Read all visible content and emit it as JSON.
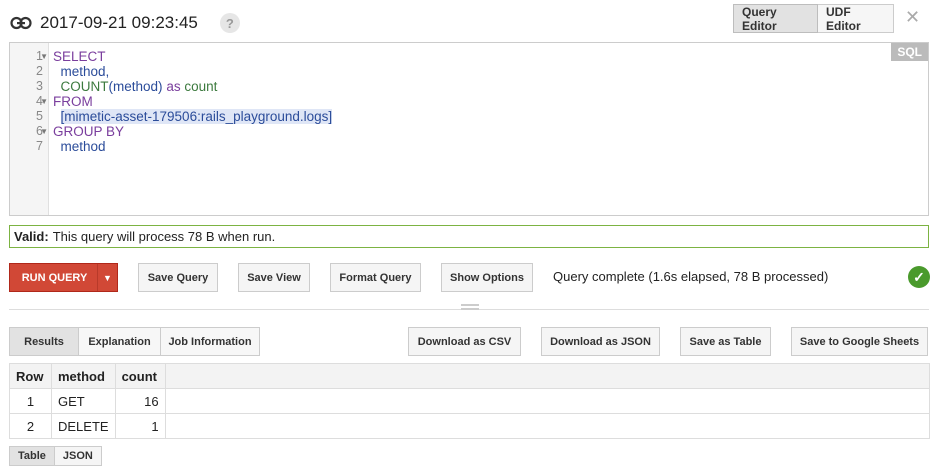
{
  "header": {
    "title": "2017-09-21 09:23:45",
    "help": "?",
    "tabs": [
      {
        "label": "Query Editor",
        "active": true
      },
      {
        "label": "UDF Editor",
        "active": false
      }
    ],
    "close": "✕"
  },
  "editor": {
    "badge": "SQL",
    "line_numbers": [
      "1",
      "2",
      "3",
      "4",
      "5",
      "6",
      "7"
    ],
    "lines": {
      "l1": "SELECT",
      "l2": "method,",
      "l3_fn": "COUNT",
      "l3_paren_open": "(",
      "l3_arg": "method",
      "l3_paren_close": ")",
      "l3_as": "as",
      "l3_alias": "count",
      "l4": "FROM",
      "l5": "[mimetic-asset-179506:rails_playground.logs]",
      "l6": "GROUP BY",
      "l7": "method"
    }
  },
  "validation": {
    "label": "Valid:",
    "message": "This query will process 78 B when run.",
    "color": "#7cb342"
  },
  "toolbar": {
    "run_query": "RUN QUERY",
    "save_query": "Save Query",
    "save_view": "Save View",
    "format_query": "Format Query",
    "show_options": "Show Options",
    "status": "Query complete (1.6s elapsed, 78 B processed)",
    "accent": "#d14836"
  },
  "results": {
    "tabs": [
      {
        "label": "Results",
        "active": true
      },
      {
        "label": "Explanation",
        "active": false
      },
      {
        "label": "Job Information",
        "active": false
      }
    ],
    "actions": {
      "csv": "Download as CSV",
      "json": "Download as JSON",
      "table": "Save as Table",
      "sheets": "Save to Google Sheets"
    },
    "columns": [
      "Row",
      "method",
      "count"
    ],
    "rows": [
      [
        "1",
        "GET",
        "16"
      ],
      [
        "2",
        "DELETE",
        "1"
      ]
    ],
    "view_tabs": [
      {
        "label": "Table",
        "active": true
      },
      {
        "label": "JSON",
        "active": false
      }
    ]
  }
}
